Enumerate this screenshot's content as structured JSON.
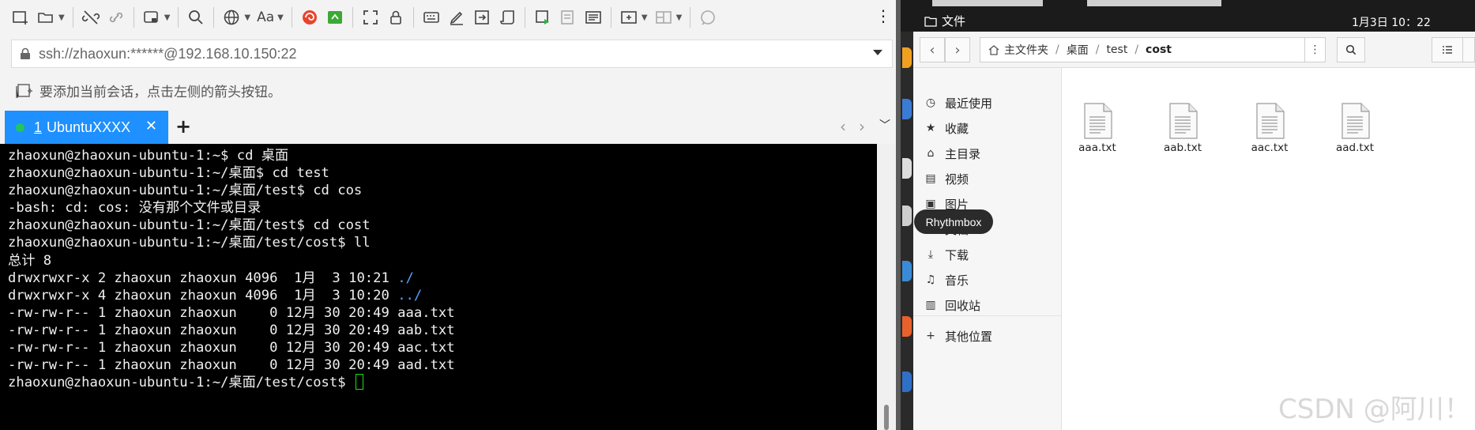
{
  "ssh_client": {
    "address": "ssh://zhaoxun:******@192.168.10.150:22",
    "hint": "要添加当前会话，点击左侧的箭头按钮。",
    "toolbar": {
      "font_button_label": "Aa"
    },
    "tabs": [
      {
        "number": "1",
        "label": "UbuntuXXXX",
        "status_color": "#22c55e",
        "accent": "#1e90ff"
      }
    ],
    "add_tab_label": "+"
  },
  "terminal": {
    "lines": [
      {
        "text": "zhaoxun@zhaoxun-ubuntu-1:~$ cd 桌面"
      },
      {
        "text": "zhaoxun@zhaoxun-ubuntu-1:~/桌面$ cd test"
      },
      {
        "text": "zhaoxun@zhaoxun-ubuntu-1:~/桌面/test$ cd cos"
      },
      {
        "text": "-bash: cd: cos: 没有那个文件或目录"
      },
      {
        "text": "zhaoxun@zhaoxun-ubuntu-1:~/桌面/test$ cd cost"
      },
      {
        "text": "zhaoxun@zhaoxun-ubuntu-1:~/桌面/test/cost$ ll"
      },
      {
        "text": "总计 8"
      },
      {
        "text": "drwxrwxr-x 2 zhaoxun zhaoxun 4096  1月  3 10:21 ",
        "dir": "./"
      },
      {
        "text": "drwxrwxr-x 4 zhaoxun zhaoxun 4096  1月  3 10:20 ",
        "dir": "../"
      },
      {
        "text": "-rw-rw-r-- 1 zhaoxun zhaoxun    0 12月 30 20:49 aaa.txt"
      },
      {
        "text": "-rw-rw-r-- 1 zhaoxun zhaoxun    0 12月 30 20:49 aab.txt"
      },
      {
        "text": "-rw-rw-r-- 1 zhaoxun zhaoxun    0 12月 30 20:49 aac.txt"
      },
      {
        "text": "-rw-rw-r-- 1 zhaoxun zhaoxun    0 12月 30 20:49 aad.txt"
      },
      {
        "text": "zhaoxun@zhaoxun-ubuntu-1:~/桌面/test/cost$ ",
        "cursor": true
      }
    ]
  },
  "ubuntu": {
    "activity_label": "文件",
    "clock": "1月3日  10：22"
  },
  "file_manager": {
    "breadcrumb": [
      "主文件夹",
      "桌面",
      "test",
      "cost"
    ],
    "sidebar": [
      {
        "label": "最近使用",
        "icon": "clock-icon"
      },
      {
        "label": "收藏",
        "icon": "star-icon"
      },
      {
        "label": "主目录",
        "icon": "home-icon"
      },
      {
        "label": "视频",
        "icon": "video-icon"
      },
      {
        "label": "图片",
        "icon": "image-icon"
      },
      {
        "label": "文档",
        "icon": "document-icon"
      },
      {
        "label": "下载",
        "icon": "download-icon"
      },
      {
        "label": "音乐",
        "icon": "music-icon"
      },
      {
        "label": "回收站",
        "icon": "trash-icon"
      },
      {
        "label": "其他位置",
        "icon": "plus-icon"
      }
    ],
    "files": [
      "aaa.txt",
      "aab.txt",
      "aac.txt",
      "aad.txt"
    ]
  },
  "tooltip": "Rhythmbox",
  "watermark": "CSDN @阿川！"
}
